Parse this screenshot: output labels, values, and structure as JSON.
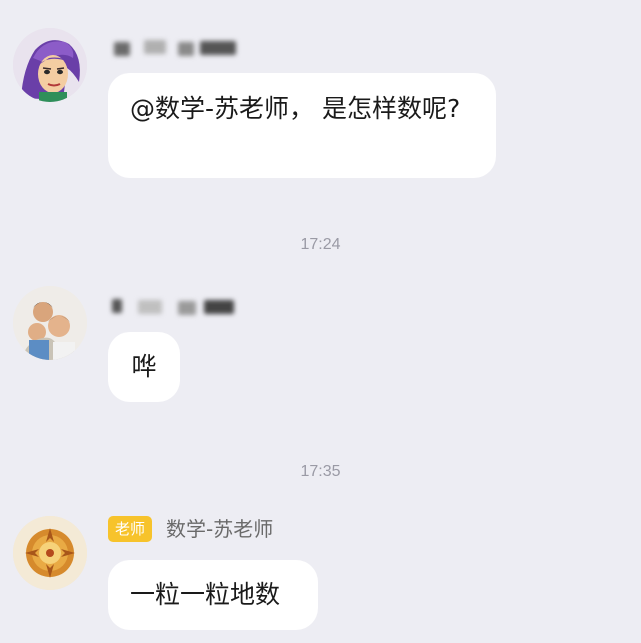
{
  "messages": [
    {
      "text": "@数学-苏老师， 是怎样数呢?",
      "avatar": "cartoon-purple-hair-avatar"
    },
    {
      "text": "哗",
      "avatar": "children-photo-avatar"
    },
    {
      "badge": "老师",
      "sender_name": "数学-苏老师",
      "text": "一粒一粒地数",
      "avatar": "golden-emblem-avatar"
    }
  ],
  "timestamps": [
    "17:24",
    "17:35"
  ],
  "colors": {
    "background": "#ededf3",
    "bubble": "#ffffff",
    "badge": "#f7c32b",
    "timestamp": "#9a9aa5"
  }
}
